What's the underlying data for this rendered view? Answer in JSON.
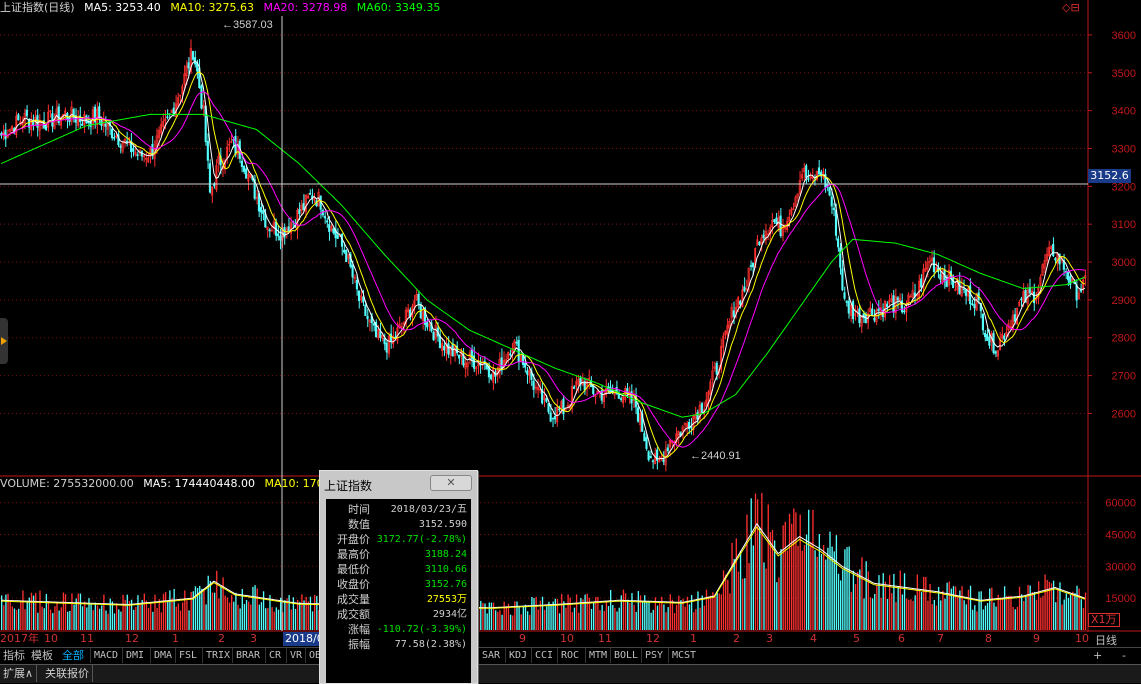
{
  "header": {
    "title": "上证指数(日线)",
    "ma5": "MA5: 3253.40",
    "ma10": "MA10: 3275.63",
    "ma20": "MA20: 3278.98",
    "ma60": "MA60: 3349.35"
  },
  "volume_header": {
    "volume": "VOLUME: 275532000.00",
    "ma5": "MA5: 174440448.00",
    "ma10": "MA10: 1703"
  },
  "annotations": {
    "high": "3587.03",
    "low": "2440.91"
  },
  "crosshair_price": "3152.6",
  "top_icons": "◇⊟",
  "x1_label": "X1万",
  "period_label": "日线",
  "colors": {
    "up": "#ff3030",
    "down": "#54ffff",
    "ma5": "#ffffff",
    "ma10": "#ffff00",
    "ma20": "#ff00ff",
    "ma60": "#00ff00",
    "axis": "#c01818"
  },
  "date_labels": [
    "2017年",
    "10",
    "11",
    "12",
    "1",
    "2",
    "3",
    "2018/03",
    "9",
    "10",
    "11",
    "12",
    "1",
    "2",
    "3",
    "4",
    "5",
    "6",
    "7",
    "8",
    "9",
    "10"
  ],
  "indicator_bar": {
    "tabs": [
      "指标",
      "模板",
      "全部"
    ],
    "items": [
      "MACD",
      "DMI",
      "DMA",
      "FSL",
      "TRIX",
      "BRAR",
      "CR",
      "VR",
      "OB",
      "SAR",
      "KDJ",
      "CCI",
      "ROC",
      "MTM",
      "BOLL",
      "PSY",
      "MCST"
    ],
    "plus": "+",
    "minus": "-"
  },
  "bottom_bar": [
    "扩展∧",
    "关联报价"
  ],
  "popup": {
    "title": "上证指数",
    "close": "✕",
    "rows": [
      {
        "k": "时间",
        "v": "2018/03/23/五",
        "c": "#d0d0d0"
      },
      {
        "k": "数值",
        "v": "3152.590",
        "c": "#d0d0d0"
      },
      {
        "k": "开盘价",
        "v": "3172.77(-2.78%)",
        "c": "#00e000"
      },
      {
        "k": "最高价",
        "v": "3188.24",
        "c": "#00e000"
      },
      {
        "k": "最低价",
        "v": "3110.66",
        "c": "#00e000"
      },
      {
        "k": "收盘价",
        "v": "3152.76",
        "c": "#00e000"
      },
      {
        "k": "成交量",
        "v": "27553万",
        "c": "#ffff00"
      },
      {
        "k": "成交额",
        "v": "2934亿",
        "c": "#d0d0d0"
      },
      {
        "k": "涨幅",
        "v": "-110.72(-3.39%)",
        "c": "#00e000"
      },
      {
        "k": "振幅",
        "v": "77.58(2.38%)",
        "c": "#d0d0d0"
      }
    ]
  },
  "chart_data": {
    "type": "candlestick",
    "price_ylim": [
      2440,
      3650
    ],
    "price_ticks": [
      2600,
      2700,
      2800,
      2900,
      3000,
      3100,
      3200,
      3300,
      3400,
      3500,
      3600
    ],
    "volume_ticks": [
      15000,
      30000,
      45000,
      60000
    ],
    "volume_unit": "万",
    "volume_ylim": [
      0,
      65000
    ],
    "close_profile": [
      [
        0,
        3335
      ],
      [
        10,
        3380
      ],
      [
        20,
        3370
      ],
      [
        30,
        3390
      ],
      [
        40,
        3375
      ],
      [
        45,
        3385
      ],
      [
        55,
        3330
      ],
      [
        65,
        3280
      ],
      [
        70,
        3290
      ],
      [
        78,
        3370
      ],
      [
        85,
        3470
      ],
      [
        90,
        3560
      ],
      [
        92,
        3500
      ],
      [
        95,
        3390
      ],
      [
        98,
        3180
      ],
      [
        102,
        3260
      ],
      [
        108,
        3310
      ],
      [
        112,
        3290
      ],
      [
        118,
        3200
      ],
      [
        125,
        3100
      ],
      [
        132,
        3080
      ],
      [
        140,
        3130
      ],
      [
        146,
        3180
      ],
      [
        150,
        3160
      ],
      [
        155,
        3090
      ],
      [
        162,
        3020
      ],
      [
        168,
        2900
      ],
      [
        176,
        2800
      ],
      [
        182,
        2780
      ],
      [
        188,
        2830
      ],
      [
        194,
        2900
      ],
      [
        198,
        2860
      ],
      [
        204,
        2810
      ],
      [
        210,
        2770
      ],
      [
        218,
        2740
      ],
      [
        226,
        2740
      ],
      [
        232,
        2700
      ],
      [
        240,
        2790
      ],
      [
        246,
        2730
      ],
      [
        252,
        2650
      ],
      [
        258,
        2600
      ],
      [
        264,
        2610
      ],
      [
        272,
        2690
      ],
      [
        278,
        2660
      ],
      [
        284,
        2650
      ],
      [
        290,
        2660
      ],
      [
        298,
        2620
      ],
      [
        304,
        2500
      ],
      [
        308,
        2460
      ],
      [
        314,
        2530
      ],
      [
        320,
        2560
      ],
      [
        326,
        2600
      ],
      [
        330,
        2630
      ],
      [
        336,
        2720
      ],
      [
        344,
        2880
      ],
      [
        350,
        2940
      ],
      [
        356,
        3070
      ],
      [
        362,
        3110
      ],
      [
        366,
        3090
      ],
      [
        372,
        3160
      ],
      [
        376,
        3240
      ],
      [
        380,
        3210
      ],
      [
        385,
        3240
      ],
      [
        389,
        3180
      ],
      [
        392,
        3090
      ],
      [
        396,
        2890
      ],
      [
        402,
        2860
      ],
      [
        410,
        2870
      ],
      [
        418,
        2890
      ],
      [
        424,
        2880
      ],
      [
        430,
        2920
      ],
      [
        436,
        3010
      ],
      [
        440,
        2980
      ],
      [
        446,
        2950
      ],
      [
        452,
        2920
      ],
      [
        458,
        2900
      ],
      [
        464,
        2790
      ],
      [
        468,
        2780
      ],
      [
        474,
        2850
      ],
      [
        480,
        2900
      ],
      [
        486,
        2920
      ],
      [
        490,
        3000
      ],
      [
        494,
        3030
      ],
      [
        500,
        2980
      ],
      [
        504,
        2920
      ],
      [
        509,
        2940
      ]
    ],
    "ma60_profile": [
      [
        0,
        3260
      ],
      [
        40,
        3360
      ],
      [
        70,
        3390
      ],
      [
        95,
        3390
      ],
      [
        120,
        3350
      ],
      [
        140,
        3260
      ],
      [
        160,
        3150
      ],
      [
        180,
        3020
      ],
      [
        200,
        2900
      ],
      [
        220,
        2820
      ],
      [
        240,
        2770
      ],
      [
        260,
        2720
      ],
      [
        280,
        2680
      ],
      [
        300,
        2630
      ],
      [
        320,
        2590
      ],
      [
        330,
        2600
      ],
      [
        345,
        2650
      ],
      [
        360,
        2760
      ],
      [
        375,
        2880
      ],
      [
        390,
        3000
      ],
      [
        400,
        3060
      ],
      [
        420,
        3050
      ],
      [
        440,
        3020
      ],
      [
        460,
        2970
      ],
      [
        480,
        2930
      ],
      [
        500,
        2940
      ],
      [
        509,
        2960
      ]
    ],
    "volume_profile": [
      [
        0,
        14000
      ],
      [
        30,
        13000
      ],
      [
        60,
        12000
      ],
      [
        90,
        15000
      ],
      [
        100,
        23000
      ],
      [
        110,
        17000
      ],
      [
        140,
        12500
      ],
      [
        170,
        12000
      ],
      [
        200,
        11000
      ],
      [
        230,
        10500
      ],
      [
        260,
        12000
      ],
      [
        290,
        14000
      ],
      [
        320,
        13000
      ],
      [
        335,
        16000
      ],
      [
        345,
        33000
      ],
      [
        355,
        50000
      ],
      [
        365,
        36000
      ],
      [
        375,
        44000
      ],
      [
        385,
        38000
      ],
      [
        395,
        30000
      ],
      [
        410,
        22000
      ],
      [
        440,
        18000
      ],
      [
        460,
        14000
      ],
      [
        480,
        16000
      ],
      [
        495,
        20000
      ],
      [
        509,
        15000
      ]
    ],
    "bar_count": 510
  }
}
